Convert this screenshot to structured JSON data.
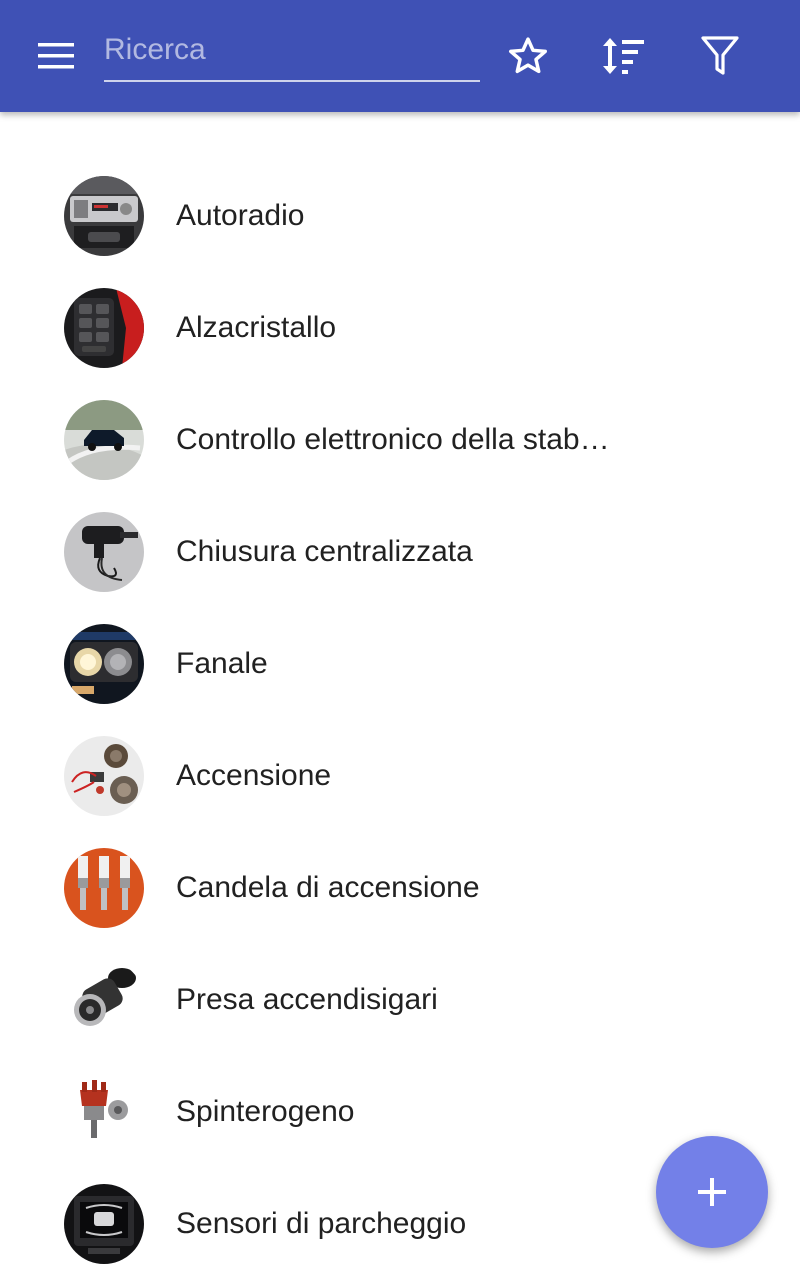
{
  "appbar": {
    "search_placeholder": "Ricerca",
    "search_value": "",
    "color": "#3f51b5",
    "icons": [
      "menu-icon",
      "star-outline-icon",
      "sort-icon",
      "filter-icon"
    ]
  },
  "items": [
    {
      "label": "Autoradio",
      "thumb": "car-radio"
    },
    {
      "label": "Alzacristallo",
      "thumb": "window-switch-panel"
    },
    {
      "label": "Controllo elettronico della stabilità",
      "thumb": "car-drifting"
    },
    {
      "label": "Chiusura centralizzata",
      "thumb": "door-lock-actuator"
    },
    {
      "label": "Fanale",
      "thumb": "headlight"
    },
    {
      "label": "Accensione",
      "thumb": "ignition-parts"
    },
    {
      "label": "Candela di accensione",
      "thumb": "spark-plugs"
    },
    {
      "label": "Presa accendisigari",
      "thumb": "cigarette-lighter-socket"
    },
    {
      "label": "Spinterogeno",
      "thumb": "distributor"
    },
    {
      "label": "Sensori di parcheggio",
      "thumb": "parking-sensor-display"
    }
  ],
  "fab": {
    "icon": "plus-icon",
    "color": "#7380e8"
  }
}
